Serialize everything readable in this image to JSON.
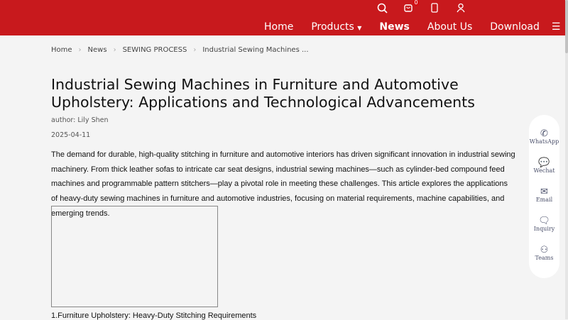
{
  "header": {
    "cart_count": "0",
    "nav": [
      "Home",
      "Products",
      "News",
      "About Us",
      "Download"
    ]
  },
  "breadcrumb": [
    "Home",
    "News",
    "SEWING PROCESS",
    "Industrial Sewing Machines ..."
  ],
  "article": {
    "title": "Industrial Sewing Machines in Furniture and Automotive Upholstery: Applications and Technological Advancements",
    "author": "author: Lily Shen",
    "date": "2025-04-11",
    "intro": "The demand for durable, high-quality stitching in furniture and automotive interiors has driven significant innovation in industrial sewing machinery. From thick leather sofas to intricate car seat designs, industrial sewing machines—such as cylinder-bed compound feed machines and programmable pattern stitchers—play a pivotal role in meeting these challenges. This article explores the applications of heavy-duty sewing machines in furniture and automotive industries, focusing on material requirements, machine capabilities, and emerging trends.",
    "section1": "1.Furniture Upholstery: Heavy-Duty Stitching Requirements"
  },
  "side": [
    "WhatsApp",
    "Wechat",
    "Email",
    "Inquiry",
    "Teams"
  ]
}
